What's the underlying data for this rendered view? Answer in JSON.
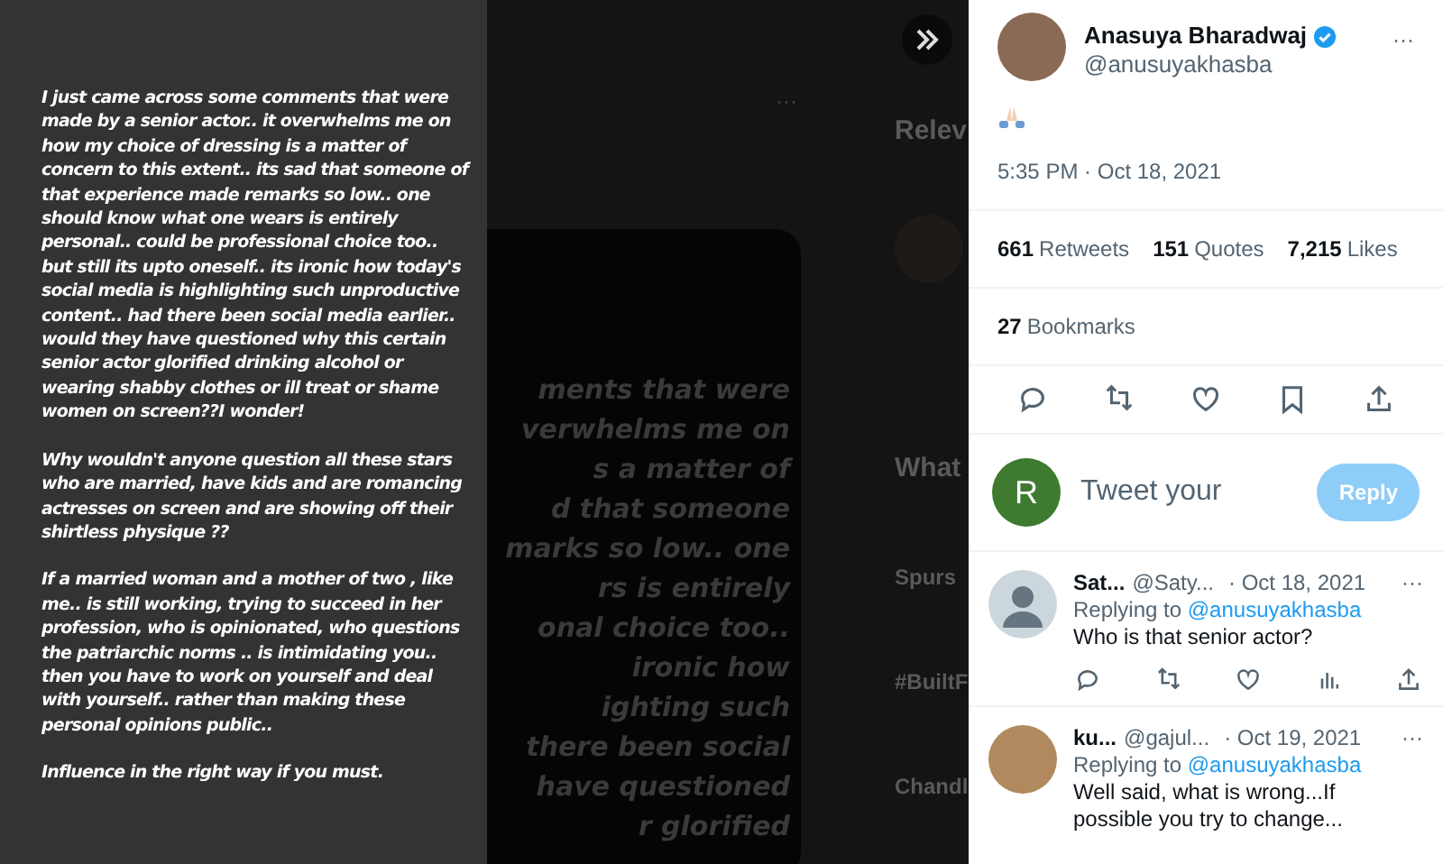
{
  "post_text": [
    "I just came across some comments that were made by a senior actor.. it overwhelms me on how my choice of dressing is a matter of concern to this extent.. its sad that someone of that experience made remarks so low.. one should know what one wears is entirely personal.. could be professional choice too.. but still its upto oneself.. its ironic how today's social media is highlighting such unproductive content.. had there been social media earlier.. would they have questioned why this certain senior actor glorified drinking alcohol or wearing shabby clothes or ill treat or shame women on screen??I wonder!",
    "Why wouldn't anyone question all these stars who are married, have kids and are romancing actresses on screen and are showing off their shirtless physique ??",
    "If a married woman and a mother of two , like me.. is still working, trying to succeed in her profession, who is opinionated, who questions the patriarchic norms .. is intimidating you.. then you have to work on yourself and deal with yourself.. rather than making these personal opinions public..",
    "Influence in the right way if you must."
  ],
  "background": {
    "more": "···",
    "image_lines": [
      "ments that were",
      "verwhelms me on",
      "s a matter of",
      "d that someone",
      "marks so low.. one",
      "rs is entirely",
      "onal choice too..",
      "ironic how",
      "ighting such",
      "there been social",
      "have questioned",
      "r glorified"
    ],
    "sidebar": [
      {
        "kind": "heading",
        "text": "Relev"
      },
      {
        "kind": "avatar"
      },
      {
        "kind": "heading",
        "text": "What"
      },
      {
        "kind": "title",
        "text": "Spurs"
      },
      {
        "kind": "title",
        "text": "#BuiltF"
      },
      {
        "kind": "title",
        "text": "Chandl"
      }
    ]
  },
  "tweet": {
    "name": "Anasuya Bharadwaj",
    "verified": true,
    "handle": "@anusuyakhasba",
    "more": "···",
    "time": "5:35 PM · Oct 18, 2021",
    "stats": [
      {
        "count": "661",
        "label": "Retweets"
      },
      {
        "count": "151",
        "label": "Quotes"
      },
      {
        "count": "7,215",
        "label": "Likes"
      }
    ],
    "bookmarks": {
      "count": "27",
      "label": "Bookmarks"
    }
  },
  "composer": {
    "avatar_letter": "R",
    "placeholder": "Tweet your",
    "button": "Reply"
  },
  "replies": [
    {
      "name": "Sat...",
      "handle": "@Saty...",
      "date": "· Oct 18, 2021",
      "more": "···",
      "replying": "Replying to",
      "mention": "@anusuyakhasba",
      "text": "Who is that senior actor?",
      "kind": "silhouette"
    },
    {
      "name": "ku...",
      "handle": "@gajul...",
      "date": "· Oct 19, 2021",
      "more": "···",
      "replying": "Replying to",
      "mention": "@anusuyakhasba",
      "text": "Well said, what is wrong...If possible you try to change...",
      "kind": "photo"
    }
  ]
}
